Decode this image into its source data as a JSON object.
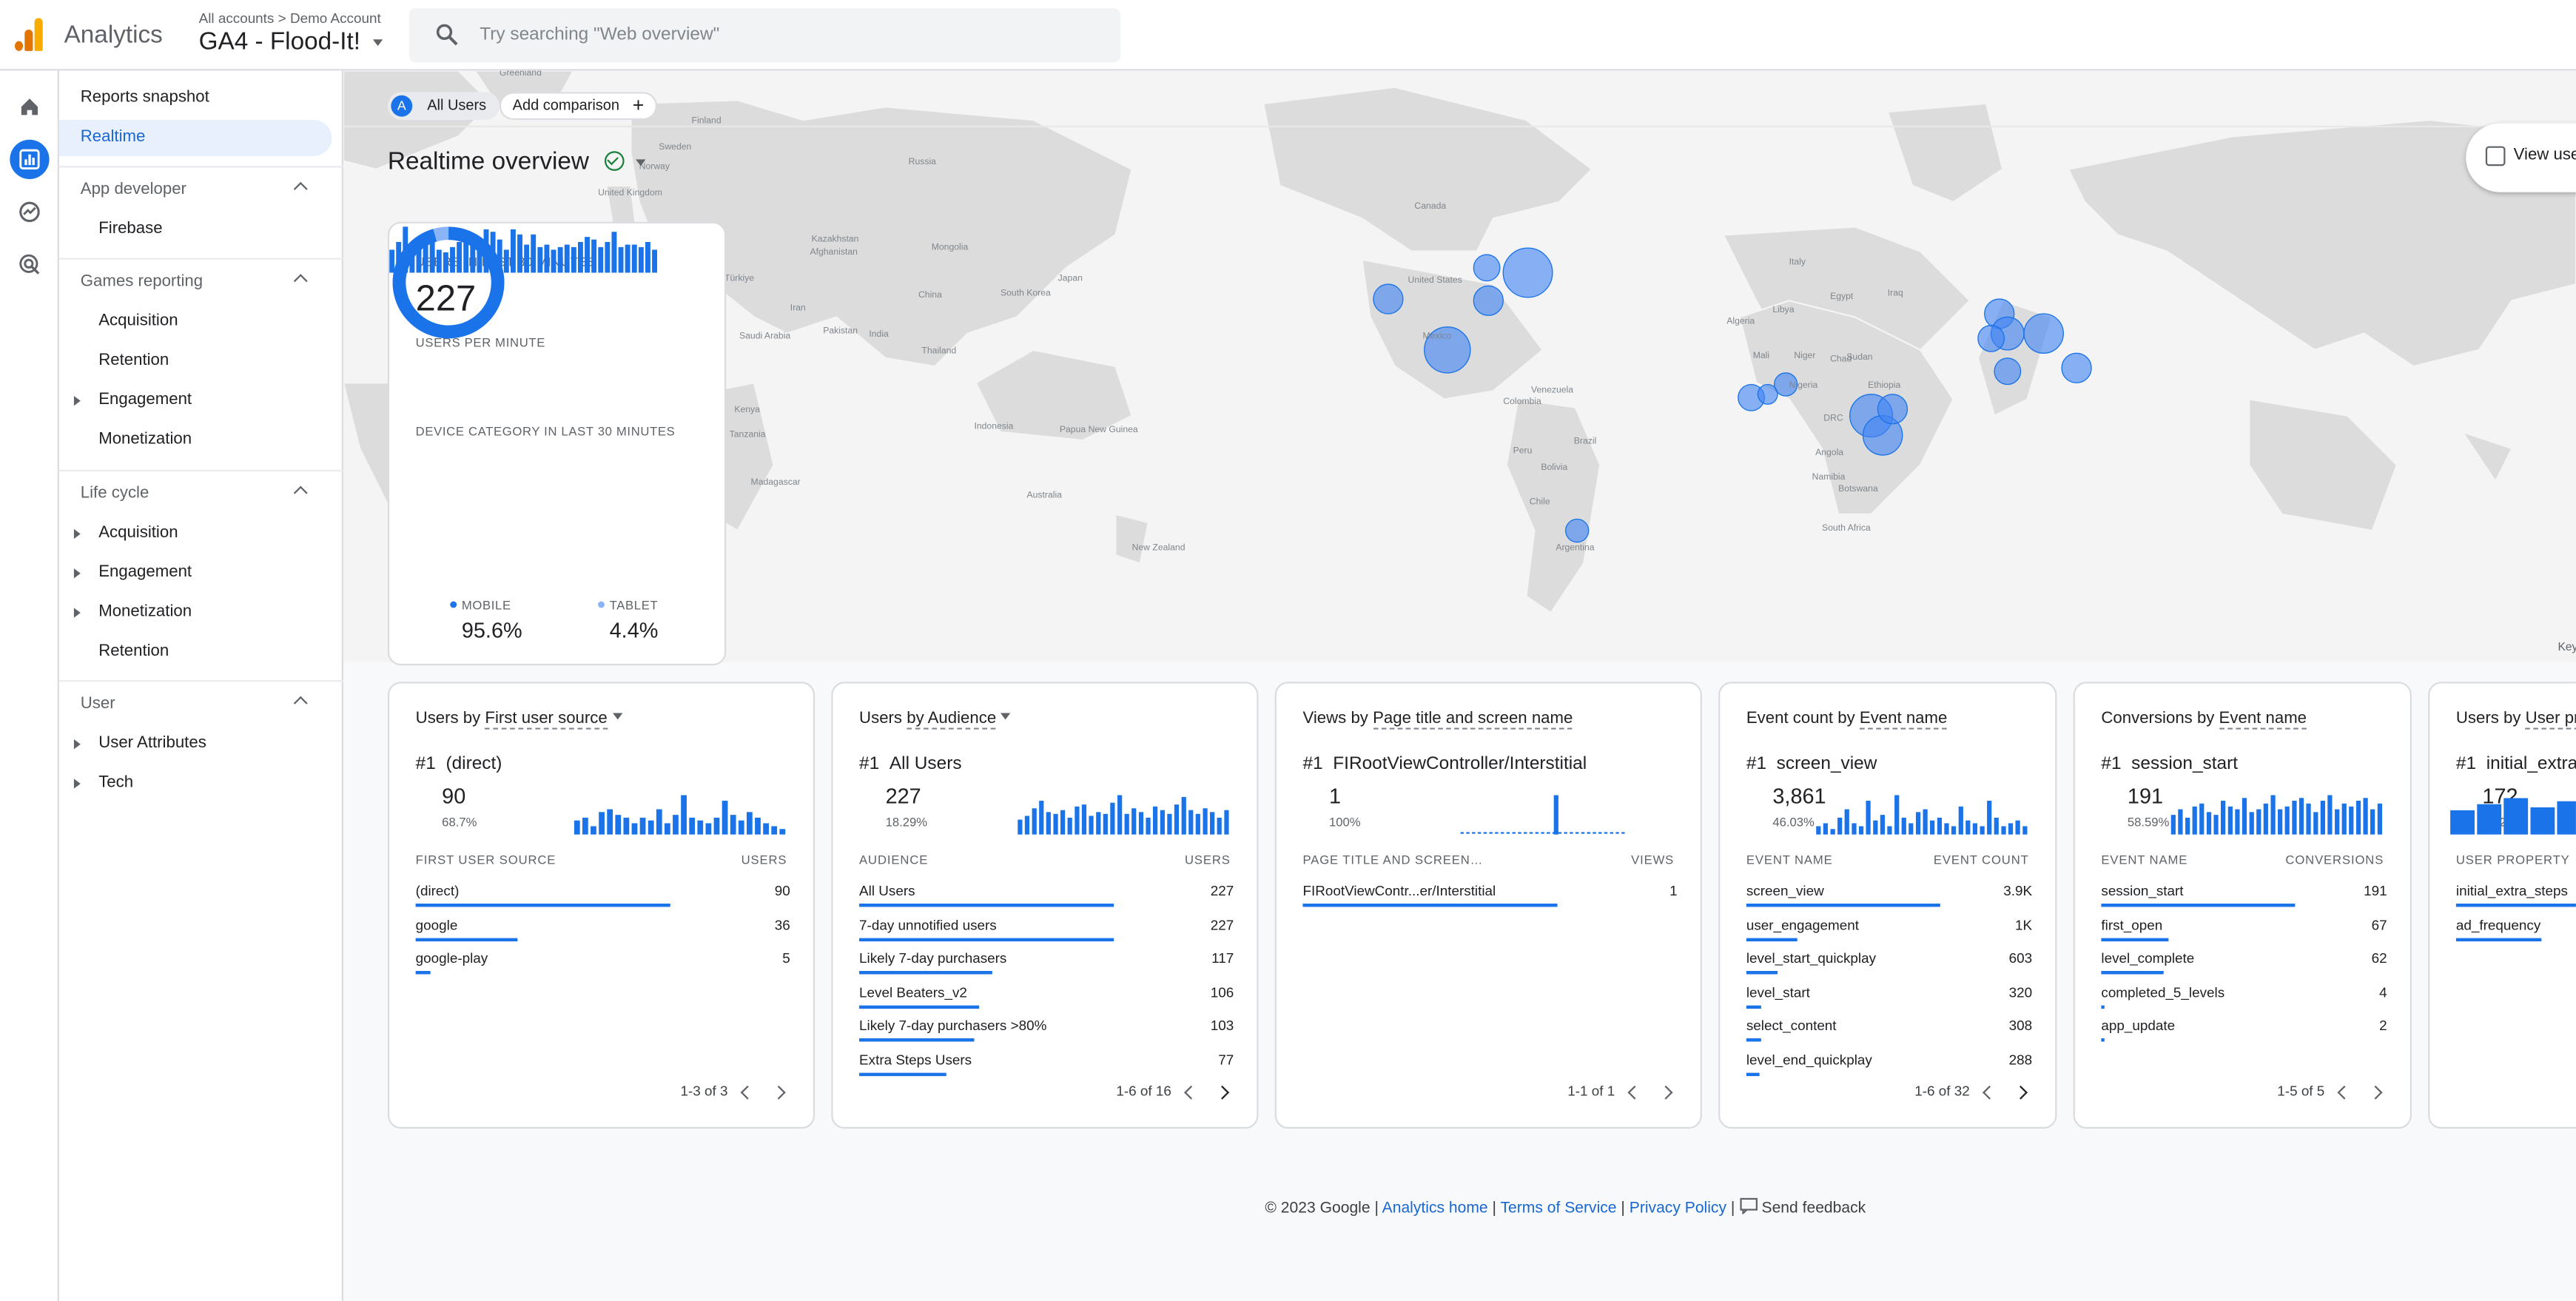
{
  "app": {
    "title": "Analytics",
    "breadcrumb_all": "All accounts",
    "breadcrumb_sep": ">",
    "breadcrumb_account": "Demo Account",
    "property": "GA4 - Flood-It!"
  },
  "search": {
    "placeholder": "Try searching \"Web overview\""
  },
  "rail": {
    "icons": [
      "home-icon",
      "reports-icon",
      "explore-icon",
      "advertising-icon"
    ],
    "active": "reports-icon"
  },
  "sidebar": {
    "reports_snapshot": "Reports snapshot",
    "realtime": "Realtime",
    "app_developer": {
      "label": "App developer",
      "items": [
        "Firebase"
      ]
    },
    "games_reporting": {
      "label": "Games reporting",
      "items": [
        "Acquisition",
        "Retention",
        "Engagement",
        "Monetization"
      ]
    },
    "life_cycle": {
      "label": "Life cycle",
      "items": [
        "Acquisition",
        "Engagement",
        "Monetization",
        "Retention"
      ]
    },
    "user": {
      "label": "User",
      "items": [
        "User Attributes",
        "Tech"
      ]
    }
  },
  "toolbar": {
    "audience_chip": "All Users",
    "audience_initial": "A",
    "add_comparison": "Add comparison",
    "add_icon": "+",
    "title": "Realtime overview",
    "view_user": "View use"
  },
  "map": {
    "labels": [
      "Greenland",
      "Finland",
      "Norway",
      "Sweden",
      "United Kingdom",
      "Russia",
      "Kazakhstan",
      "Mongolia",
      "China",
      "Japan",
      "South Korea",
      "Türkiye",
      "Iran",
      "Afghanistan",
      "Pakistan",
      "India",
      "Saudi Arabia",
      "Egypt",
      "Libya",
      "Algeria",
      "Mali",
      "Niger",
      "Chad",
      "Sudan",
      "Nigeria",
      "Ethiopia",
      "Kenya",
      "DRC",
      "Tanzania",
      "Angola",
      "Namibia",
      "Botswana",
      "Madagascar",
      "South Africa",
      "Thailand",
      "Indonesia",
      "Papua New Guinea",
      "Australia",
      "New Zealand",
      "Canada",
      "United States",
      "Mexico",
      "Venezuela",
      "Colombia",
      "Peru",
      "Brazil",
      "Bolivia",
      "Chile",
      "Argentina",
      "Italy",
      "Iraq"
    ],
    "key": "Key"
  },
  "users_card": {
    "users_30_label": "USERS IN LAST 30 MINUTES",
    "users_30": "227",
    "upm_label": "USERS PER MINUTE",
    "upm_values": [
      9,
      12,
      18,
      8,
      10,
      11,
      12,
      9,
      8,
      10,
      12,
      14,
      11,
      10,
      17,
      16,
      13,
      9,
      17,
      15,
      11,
      15,
      10,
      11,
      9,
      10,
      11,
      10,
      12,
      14,
      13,
      10,
      12,
      16,
      10,
      11,
      11,
      10,
      12,
      9
    ],
    "device_label": "DEVICE CATEGORY IN LAST 30 MINUTES",
    "devices": [
      {
        "name": "MOBILE",
        "pct": "95.6%",
        "value": 95.6
      },
      {
        "name": "TABLET",
        "pct": "4.4%",
        "value": 4.4
      }
    ]
  },
  "cards": [
    {
      "title_pre": "Users by ",
      "title_dim": "First user source",
      "dropdown": true,
      "top_rank": "#1",
      "top_name": "(direct)",
      "top_value": "90",
      "top_pct": "68.7%",
      "col1": "FIRST USER SOURCE",
      "col2": "USERS",
      "rows": [
        {
          "name": "(direct)",
          "value": "90",
          "share": 1.0
        },
        {
          "name": "google",
          "value": "36",
          "share": 0.4
        },
        {
          "name": "google-play",
          "value": "5",
          "share": 0.06
        }
      ],
      "pagination": "1-3 of 3",
      "spark": [
        5,
        6,
        3,
        8,
        9,
        7,
        6,
        4,
        6,
        5,
        9,
        4,
        7,
        14,
        6,
        5,
        4,
        6,
        12,
        7,
        5,
        8,
        6,
        4,
        3,
        2
      ]
    },
    {
      "title_pre": "Users ",
      "title_dim": "by Audience",
      "dropdown": true,
      "top_rank": "#1",
      "top_name": "All Users",
      "top_value": "227",
      "top_pct": "18.29%",
      "col1": "AUDIENCE",
      "col2": "USERS",
      "rows": [
        {
          "name": "All Users",
          "value": "227",
          "share": 1.0
        },
        {
          "name": "7-day unnotified users",
          "value": "227",
          "share": 1.0
        },
        {
          "name": "Likely 7-day purchasers",
          "value": "117",
          "share": 0.52
        },
        {
          "name": "Level Beaters_v2",
          "value": "106",
          "share": 0.47
        },
        {
          "name": "Likely 7-day purchasers >80%",
          "value": "103",
          "share": 0.45
        },
        {
          "name": "Extra Steps Users",
          "value": "77",
          "share": 0.34
        }
      ],
      "pagination": "1-6 of 16",
      "spark": [
        8,
        10,
        14,
        18,
        12,
        11,
        13,
        9,
        15,
        16,
        10,
        12,
        11,
        17,
        21,
        11,
        14,
        12,
        9,
        15,
        13,
        11,
        16,
        20,
        13,
        11,
        14,
        12,
        9,
        13
      ]
    },
    {
      "title_pre": "Views by ",
      "title_dim": "Page title and screen name",
      "dropdown": false,
      "top_rank": "#1",
      "top_name": "FIRootViewController/Interstitial",
      "top_value": "1",
      "top_pct": "100%",
      "col1": "PAGE TITLE AND SCREEN…",
      "col2": "VIEWS",
      "rows": [
        {
          "name": "FIRootViewContr...er/Interstitial",
          "value": "1",
          "share": 1.0
        }
      ],
      "pagination": "1-1 of 1",
      "spark": [
        0,
        0,
        0,
        0,
        0,
        0,
        0,
        0,
        0,
        0,
        0,
        0,
        0,
        1,
        0,
        0,
        0,
        0,
        0,
        0,
        0,
        0,
        0,
        0,
        0,
        0,
        0,
        0,
        0,
        0
      ]
    },
    {
      "title_pre": "Event count by ",
      "title_dim": "Event name",
      "dropdown": false,
      "top_rank": "#1",
      "top_name": "screen_view",
      "top_value": "3,861",
      "top_pct": "46.03%",
      "col1": "EVENT NAME",
      "col2": "EVENT COUNT",
      "rows": [
        {
          "name": "screen_view",
          "value": "3.9K",
          "share": 1.0
        },
        {
          "name": "user_engagement",
          "value": "1K",
          "share": 0.26
        },
        {
          "name": "level_start_quickplay",
          "value": "603",
          "share": 0.16
        },
        {
          "name": "level_start",
          "value": "320",
          "share": 0.08
        },
        {
          "name": "select_content",
          "value": "308",
          "share": 0.08
        },
        {
          "name": "level_end_quickplay",
          "value": "288",
          "share": 0.07
        }
      ],
      "pagination": "1-6 of 32",
      "spark": [
        3,
        4,
        2,
        6,
        9,
        4,
        3,
        12,
        5,
        7,
        3,
        14,
        6,
        4,
        8,
        9,
        5,
        6,
        4,
        3,
        10,
        5,
        4,
        3,
        12,
        6,
        3,
        4,
        5,
        3
      ]
    },
    {
      "title_pre": "Conversions by ",
      "title_dim": "Event name",
      "dropdown": false,
      "top_rank": "#1",
      "top_name": "session_start",
      "top_value": "191",
      "top_pct": "58.59%",
      "col1": "EVENT NAME",
      "col2": "CONVERSIONS",
      "rows": [
        {
          "name": "session_start",
          "value": "191",
          "share": 1.0
        },
        {
          "name": "first_open",
          "value": "67",
          "share": 0.35
        },
        {
          "name": "level_complete",
          "value": "62",
          "share": 0.32
        },
        {
          "name": "completed_5_levels",
          "value": "4",
          "share": 0.02
        },
        {
          "name": "app_update",
          "value": "2",
          "share": 0.01
        }
      ],
      "pagination": "1-5 of 5",
      "spark": [
        7,
        9,
        6,
        10,
        11,
        8,
        7,
        12,
        10,
        9,
        13,
        8,
        9,
        11,
        14,
        9,
        10,
        12,
        13,
        11,
        8,
        12,
        14,
        9,
        11,
        10,
        12,
        13,
        9,
        11
      ]
    },
    {
      "title_pre": "Users by ",
      "title_dim": "User pr",
      "dropdown": false,
      "top_rank": "#1",
      "top_name": "initial_extra",
      "top_value": "172",
      "top_pct": "63.24%",
      "col1": "USER PROPERTY",
      "col2": "",
      "rows": [
        {
          "name": "initial_extra_steps",
          "value": "",
          "share": 1.0
        },
        {
          "name": "ad_frequency",
          "value": "",
          "share": 0.6
        }
      ],
      "pagination": "",
      "spark": [
        8,
        10,
        12,
        9,
        11,
        13,
        10,
        12
      ]
    }
  ],
  "footer": {
    "copyright": "© 2023 Google |",
    "analytics_home": "Analytics home",
    "sep1": "|",
    "terms": "Terms of Service",
    "sep2": "|",
    "privacy": "Privacy Policy",
    "sep3": "|",
    "feedback": "Send feedback"
  },
  "colors": {
    "accent": "#1a73e8",
    "selected_bg": "#e8f0fe",
    "bubble": "#4285f4"
  }
}
